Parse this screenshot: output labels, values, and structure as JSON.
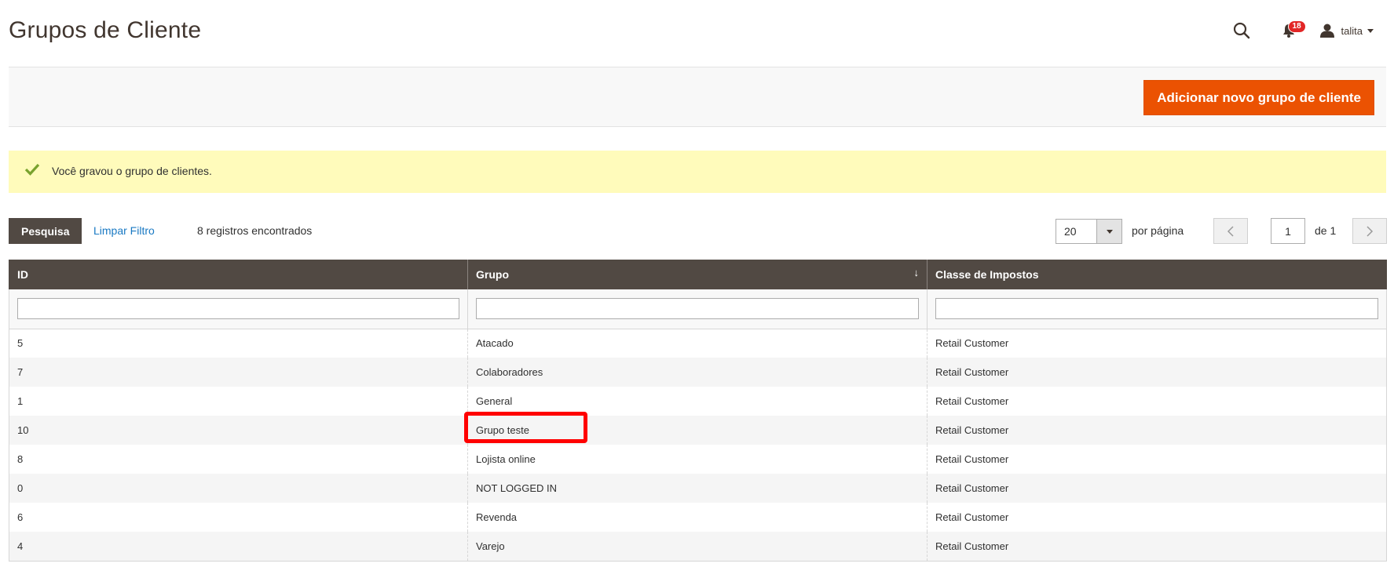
{
  "header": {
    "title": "Grupos de Cliente",
    "notifications_count": "18",
    "user_name": "talita"
  },
  "actions": {
    "add_button_label": "Adicionar novo grupo de cliente"
  },
  "message": {
    "text": "Você gravou o grupo de clientes."
  },
  "toolbar": {
    "search_label": "Pesquisa",
    "reset_label": "Limpar Filtro",
    "records_found": "8 registros encontrados",
    "per_page_value": "20",
    "per_page_label": "por página",
    "current_page": "1",
    "page_total": "de 1"
  },
  "columns": {
    "id": "ID",
    "group": "Grupo",
    "tax_class": "Classe de Impostos"
  },
  "rows": [
    {
      "id": "5",
      "group": "Atacado",
      "tax_class": "Retail Customer"
    },
    {
      "id": "7",
      "group": "Colaboradores",
      "tax_class": "Retail Customer"
    },
    {
      "id": "1",
      "group": "General",
      "tax_class": "Retail Customer"
    },
    {
      "id": "10",
      "group": "Grupo teste",
      "tax_class": "Retail Customer"
    },
    {
      "id": "8",
      "group": "Lojista online",
      "tax_class": "Retail Customer"
    },
    {
      "id": "0",
      "group": "NOT LOGGED IN",
      "tax_class": "Retail Customer"
    },
    {
      "id": "6",
      "group": "Revenda",
      "tax_class": "Retail Customer"
    },
    {
      "id": "4",
      "group": "Varejo",
      "tax_class": "Retail Customer"
    }
  ],
  "colors": {
    "accent": "#eb5202",
    "header_bg": "#514943",
    "message_bg": "#fffbbb",
    "highlight": "#ff0000"
  }
}
